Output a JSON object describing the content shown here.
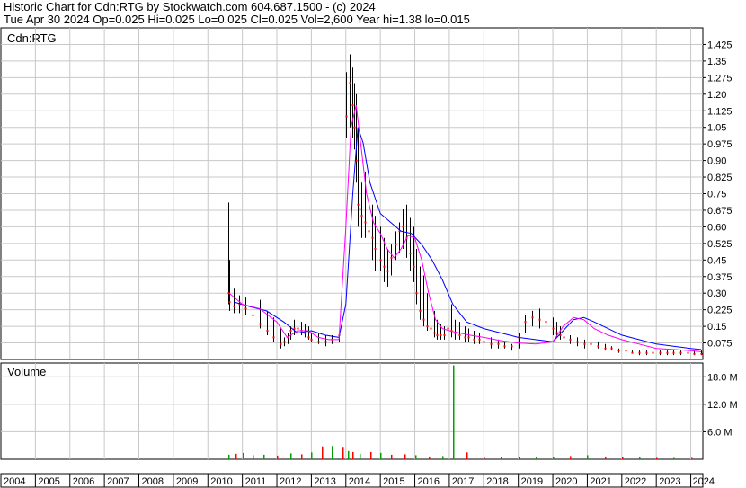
{
  "header": {
    "line1": "Historic Chart for Cdn:RTG by Stockwatch.com 604.687.1500 - (c) 2024",
    "line2": "Tue Apr 30 2024  Op=0.025  Hi=0.025  Lo=0.025  Cl=0.025  Vol=2,600  Year hi=1.38  lo=0.015"
  },
  "chart_data": [
    {
      "type": "line",
      "panel": "price",
      "title": "Cdn:RTG",
      "ylim": [
        0,
        1.5
      ],
      "y_ticks": [
        "1.425",
        "1.35",
        "1.275",
        "1.20",
        "1.125",
        "1.05",
        "0.975",
        "0.90",
        "0.825",
        "0.75",
        "0.675",
        "0.60",
        "0.525",
        "0.45",
        "0.375",
        "0.30",
        "0.225",
        "0.15",
        "0.075"
      ],
      "y_tick_values": [
        1.425,
        1.35,
        1.275,
        1.2,
        1.125,
        1.05,
        0.975,
        0.9,
        0.825,
        0.75,
        0.675,
        0.6,
        0.525,
        0.45,
        0.375,
        0.3,
        0.225,
        0.15,
        0.075
      ],
      "x_ticks": [
        "2004",
        "2005",
        "2006",
        "2007",
        "2008",
        "2009",
        "2010",
        "2011",
        "2012",
        "2013",
        "2014",
        "2015",
        "2016",
        "2017",
        "2018",
        "2019",
        "2020",
        "2021",
        "2022",
        "2023",
        "2024"
      ],
      "x_range": [
        2004.0,
        2024.35
      ],
      "grid": true,
      "colors": {
        "price_bar": "#000000",
        "close_dot": "#ff0000",
        "ma_short": "#ff00ff",
        "ma_long": "#0000ff"
      },
      "price_x": [
        2010.58,
        2010.62,
        2010.75,
        2010.9,
        2011.1,
        2011.3,
        2011.5,
        2011.7,
        2011.9,
        2012.1,
        2012.2,
        2012.3,
        2012.4,
        2012.5,
        2012.6,
        2012.7,
        2012.8,
        2012.9,
        2013.0,
        2013.2,
        2013.4,
        2013.6,
        2013.8,
        2014.0,
        2014.1,
        2014.2,
        2014.25,
        2014.3,
        2014.35,
        2014.4,
        2014.45,
        2014.55,
        2014.65,
        2014.75,
        2014.85,
        2015.0,
        2015.1,
        2015.2,
        2015.3,
        2015.45,
        2015.55,
        2015.65,
        2015.75,
        2015.85,
        2015.95,
        2016.05,
        2016.15,
        2016.25,
        2016.35,
        2016.45,
        2016.55,
        2016.65,
        2016.75,
        2016.85,
        2016.95,
        2017.05,
        2017.15,
        2017.3,
        2017.45,
        2017.55,
        2017.7,
        2017.85,
        2018.0,
        2018.2,
        2018.4,
        2018.6,
        2018.8,
        2019.0,
        2019.2,
        2019.4,
        2019.6,
        2019.8,
        2020.0,
        2020.1,
        2020.2,
        2020.3,
        2020.5,
        2020.7,
        2020.9,
        2021.1,
        2021.3,
        2021.5,
        2021.7,
        2021.9,
        2022.1,
        2022.3,
        2022.5,
        2022.7,
        2022.9,
        2023.1,
        2023.3,
        2023.5,
        2023.7,
        2023.9,
        2024.1,
        2024.3
      ],
      "high": [
        0.71,
        0.45,
        0.32,
        0.29,
        0.28,
        0.26,
        0.27,
        0.22,
        0.19,
        0.14,
        0.1,
        0.12,
        0.15,
        0.18,
        0.17,
        0.17,
        0.16,
        0.15,
        0.12,
        0.12,
        0.11,
        0.11,
        0.12,
        1.3,
        1.38,
        1.32,
        1.25,
        1.2,
        1.05,
        0.95,
        0.8,
        0.85,
        0.75,
        0.7,
        0.65,
        0.6,
        0.55,
        0.5,
        0.52,
        0.58,
        0.62,
        0.68,
        0.7,
        0.64,
        0.6,
        0.5,
        0.42,
        0.38,
        0.3,
        0.25,
        0.22,
        0.18,
        0.16,
        0.15,
        0.56,
        0.25,
        0.18,
        0.17,
        0.15,
        0.14,
        0.13,
        0.12,
        0.11,
        0.1,
        0.09,
        0.08,
        0.07,
        0.12,
        0.2,
        0.22,
        0.23,
        0.22,
        0.19,
        0.17,
        0.15,
        0.13,
        0.11,
        0.1,
        0.09,
        0.08,
        0.08,
        0.07,
        0.06,
        0.05,
        0.05,
        0.04,
        0.04,
        0.04,
        0.04,
        0.04,
        0.04,
        0.04,
        0.04,
        0.04,
        0.04,
        0.04
      ],
      "low": [
        0.25,
        0.22,
        0.21,
        0.21,
        0.2,
        0.17,
        0.14,
        0.11,
        0.08,
        0.05,
        0.06,
        0.07,
        0.09,
        0.11,
        0.12,
        0.11,
        0.1,
        0.09,
        0.08,
        0.07,
        0.06,
        0.07,
        0.08,
        1.0,
        1.05,
        1.0,
        0.95,
        0.8,
        0.6,
        0.55,
        0.55,
        0.55,
        0.5,
        0.45,
        0.4,
        0.4,
        0.35,
        0.33,
        0.38,
        0.45,
        0.48,
        0.5,
        0.46,
        0.4,
        0.35,
        0.25,
        0.18,
        0.15,
        0.13,
        0.12,
        0.1,
        0.09,
        0.09,
        0.09,
        0.09,
        0.1,
        0.09,
        0.09,
        0.08,
        0.08,
        0.07,
        0.07,
        0.06,
        0.05,
        0.05,
        0.05,
        0.04,
        0.05,
        0.12,
        0.15,
        0.14,
        0.13,
        0.11,
        0.1,
        0.09,
        0.08,
        0.07,
        0.06,
        0.05,
        0.05,
        0.05,
        0.04,
        0.04,
        0.03,
        0.03,
        0.03,
        0.02,
        0.02,
        0.02,
        0.02,
        0.02,
        0.02,
        0.02,
        0.02,
        0.02,
        0.02
      ],
      "close": [
        0.3,
        0.26,
        0.24,
        0.25,
        0.23,
        0.2,
        0.16,
        0.13,
        0.1,
        0.07,
        0.08,
        0.1,
        0.13,
        0.14,
        0.14,
        0.13,
        0.12,
        0.1,
        0.09,
        0.08,
        0.08,
        0.09,
        0.11,
        1.1,
        1.25,
        1.15,
        1.05,
        0.9,
        0.7,
        0.68,
        0.65,
        0.62,
        0.58,
        0.55,
        0.5,
        0.45,
        0.42,
        0.4,
        0.46,
        0.52,
        0.58,
        0.6,
        0.55,
        0.48,
        0.42,
        0.3,
        0.22,
        0.18,
        0.15,
        0.14,
        0.12,
        0.11,
        0.11,
        0.11,
        0.14,
        0.13,
        0.12,
        0.11,
        0.1,
        0.1,
        0.09,
        0.09,
        0.08,
        0.07,
        0.07,
        0.06,
        0.06,
        0.1,
        0.17,
        0.19,
        0.18,
        0.17,
        0.14,
        0.12,
        0.11,
        0.1,
        0.09,
        0.08,
        0.07,
        0.07,
        0.06,
        0.05,
        0.05,
        0.04,
        0.04,
        0.03,
        0.03,
        0.03,
        0.03,
        0.03,
        0.03,
        0.03,
        0.03,
        0.03,
        0.025,
        0.025
      ],
      "ma_short_x": [
        2010.62,
        2011.0,
        2011.5,
        2012.0,
        2012.3,
        2012.6,
        2012.9,
        2013.2,
        2013.5,
        2013.8,
        2014.0,
        2014.15,
        2014.3,
        2014.45,
        2014.6,
        2014.8,
        2015.0,
        2015.2,
        2015.4,
        2015.6,
        2015.8,
        2016.0,
        2016.2,
        2016.4,
        2016.6,
        2016.8,
        2017.0,
        2017.3,
        2017.6,
        2018.0,
        2018.5,
        2019.0,
        2019.5,
        2020.0,
        2020.3,
        2020.6,
        2020.9,
        2021.2,
        2021.6,
        2022.0,
        2022.5,
        2023.0,
        2023.5,
        2024.0,
        2024.3
      ],
      "ma_short": [
        0.3,
        0.25,
        0.23,
        0.17,
        0.1,
        0.13,
        0.13,
        0.1,
        0.09,
        0.09,
        0.6,
        1.05,
        1.15,
        0.95,
        0.75,
        0.62,
        0.57,
        0.5,
        0.46,
        0.5,
        0.56,
        0.55,
        0.45,
        0.3,
        0.18,
        0.14,
        0.13,
        0.12,
        0.11,
        0.1,
        0.085,
        0.075,
        0.07,
        0.08,
        0.15,
        0.19,
        0.18,
        0.14,
        0.11,
        0.09,
        0.07,
        0.05,
        0.045,
        0.04,
        0.035
      ],
      "ma_long_x": [
        2010.75,
        2011.2,
        2011.7,
        2012.2,
        2012.6,
        2013.0,
        2013.4,
        2013.8,
        2014.0,
        2014.2,
        2014.35,
        2014.5,
        2014.7,
        2015.0,
        2015.3,
        2015.6,
        2015.9,
        2016.2,
        2016.5,
        2016.8,
        2017.1,
        2017.5,
        2018.0,
        2018.5,
        2019.0,
        2019.5,
        2020.0,
        2020.3,
        2020.6,
        2020.9,
        2021.2,
        2021.6,
        2022.0,
        2022.5,
        2023.0,
        2023.5,
        2024.0,
        2024.3
      ],
      "ma_long": [
        0.26,
        0.24,
        0.22,
        0.17,
        0.12,
        0.13,
        0.11,
        0.1,
        0.25,
        0.75,
        1.05,
        0.98,
        0.8,
        0.66,
        0.62,
        0.58,
        0.57,
        0.52,
        0.45,
        0.36,
        0.25,
        0.17,
        0.14,
        0.12,
        0.1,
        0.09,
        0.08,
        0.13,
        0.18,
        0.19,
        0.17,
        0.14,
        0.11,
        0.09,
        0.07,
        0.06,
        0.05,
        0.045
      ]
    },
    {
      "type": "bar",
      "panel": "volume",
      "title": "Volume",
      "ylim": [
        0,
        21
      ],
      "y_ticks": [
        "18.0 M",
        "12.0 M",
        "6.0 M"
      ],
      "y_tick_values": [
        18,
        12,
        6
      ],
      "colors": {
        "up": "#00a000",
        "down": "#ff0000"
      },
      "x": [
        2010.6,
        2010.8,
        2011.0,
        2011.3,
        2011.6,
        2012.0,
        2012.4,
        2012.7,
        2013.0,
        2013.3,
        2013.6,
        2013.9,
        2014.05,
        2014.2,
        2014.4,
        2014.7,
        2015.0,
        2015.3,
        2015.7,
        2016.0,
        2016.4,
        2016.8,
        2017.1,
        2017.5,
        2018.0,
        2018.5,
        2019.0,
        2019.5,
        2020.0,
        2020.5,
        2021.0,
        2021.5,
        2022.0,
        2022.5,
        2023.0,
        2023.5,
        2024.0
      ],
      "values": [
        1.0,
        1.2,
        1.4,
        0.9,
        1.0,
        0.8,
        1.3,
        1.1,
        1.5,
        2.8,
        2.9,
        2.7,
        1.8,
        1.6,
        1.2,
        1.6,
        1.4,
        1.0,
        1.1,
        0.9,
        0.6,
        0.7,
        20.5,
        1.5,
        0.6,
        0.5,
        0.4,
        0.4,
        0.5,
        0.7,
        0.9,
        0.6,
        0.5,
        0.4,
        0.3,
        0.3,
        0.3
      ],
      "up": [
        true,
        false,
        true,
        false,
        true,
        false,
        true,
        false,
        true,
        false,
        true,
        false,
        true,
        false,
        true,
        false,
        true,
        false,
        false,
        true,
        false,
        true,
        true,
        false,
        false,
        true,
        false,
        true,
        true,
        false,
        true,
        false,
        false,
        true,
        false,
        true,
        false
      ]
    }
  ]
}
